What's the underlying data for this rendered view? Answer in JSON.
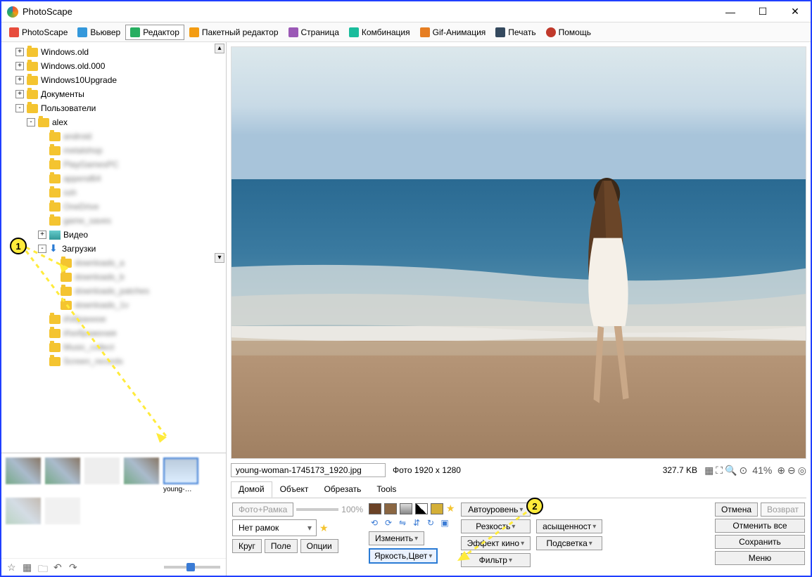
{
  "app": {
    "title": "PhotoScape"
  },
  "toolbar": {
    "tabs": [
      {
        "label": "PhotoScape",
        "active": false
      },
      {
        "label": "Вьювер",
        "active": false
      },
      {
        "label": "Редактор",
        "active": true
      },
      {
        "label": "Пакетный редактор",
        "active": false
      },
      {
        "label": "Страница",
        "active": false
      },
      {
        "label": "Комбинация",
        "active": false
      },
      {
        "label": "Gif-Анимация",
        "active": false
      },
      {
        "label": "Печать",
        "active": false
      },
      {
        "label": "Помощь",
        "active": false
      }
    ]
  },
  "tree": {
    "nodes": [
      {
        "depth": 1,
        "toggle": "+",
        "icon": "folder",
        "label": "Windows.old"
      },
      {
        "depth": 1,
        "toggle": "+",
        "icon": "folder",
        "label": "Windows.old.000"
      },
      {
        "depth": 1,
        "toggle": "+",
        "icon": "folder",
        "label": "Windows10Upgrade"
      },
      {
        "depth": 1,
        "toggle": "+",
        "icon": "folder",
        "label": "Документы"
      },
      {
        "depth": 1,
        "toggle": "-",
        "icon": "folder",
        "label": "Пользователи"
      },
      {
        "depth": 2,
        "toggle": "-",
        "icon": "folder",
        "label": "alex"
      },
      {
        "depth": 3,
        "toggle": "",
        "icon": "folder",
        "label": "android",
        "blur": true
      },
      {
        "depth": 3,
        "toggle": "",
        "icon": "folder",
        "label": "metalshop",
        "blur": true
      },
      {
        "depth": 3,
        "toggle": "",
        "icon": "folder",
        "label": "PlayGamesPC",
        "blur": true
      },
      {
        "depth": 3,
        "toggle": "",
        "icon": "folder",
        "label": "append64",
        "blur": true
      },
      {
        "depth": 3,
        "toggle": "",
        "icon": "folder",
        "label": "ssh",
        "blur": true
      },
      {
        "depth": 3,
        "toggle": "",
        "icon": "onedrive",
        "label": "OneDrive",
        "blur": true
      },
      {
        "depth": 3,
        "toggle": "",
        "icon": "folder",
        "label": "game_saves",
        "blur": true
      },
      {
        "depth": 3,
        "toggle": "+",
        "icon": "video",
        "label": "Видео"
      },
      {
        "depth": 3,
        "toggle": "-",
        "icon": "download",
        "label": "Загрузки"
      },
      {
        "depth": 4,
        "toggle": "",
        "icon": "folder",
        "label": "downloads_a",
        "blur": true
      },
      {
        "depth": 4,
        "toggle": "",
        "icon": "folder",
        "label": "downloads_b",
        "blur": true
      },
      {
        "depth": 4,
        "toggle": "",
        "icon": "folder",
        "label": "downloads_patches",
        "blur": true
      },
      {
        "depth": 4,
        "toggle": "",
        "icon": "folder",
        "label": "downloads_1v",
        "blur": true
      },
      {
        "depth": 3,
        "toggle": "",
        "icon": "folder",
        "label": "Избранное",
        "blur": true
      },
      {
        "depth": 3,
        "toggle": "",
        "icon": "folder",
        "label": "Изображения",
        "blur": true
      },
      {
        "depth": 3,
        "toggle": "",
        "icon": "folder",
        "label": "Music_collect",
        "blur": true
      },
      {
        "depth": 3,
        "toggle": "",
        "icon": "folder",
        "label": "Screen_records",
        "blur": true
      }
    ]
  },
  "thumbs": {
    "selected_label": "young-…"
  },
  "file": {
    "name": "young-woman-1745173_1920.jpg",
    "dimensions_label": "Фото 1920 x 1280",
    "size_label": "327.7 KB",
    "zoom": "41%"
  },
  "edit_tabs": [
    {
      "label": "Домой",
      "active": true
    },
    {
      "label": "Объект",
      "active": false
    },
    {
      "label": "Обрезать",
      "active": false
    },
    {
      "label": "Tools",
      "active": false
    }
  ],
  "panel": {
    "photo_frame": "Фото+Рамка",
    "slider_pct": "100%",
    "frame_select": "Нет рамок",
    "circle": "Круг",
    "field": "Поле",
    "options": "Опции",
    "autolevel": "Автоуровень",
    "sharpness": "Резкость",
    "saturation": "асыщенност",
    "resize": "Изменить",
    "film_effect": "Эффект кино",
    "highlight": "Подсветка",
    "brightness_color": "Яркость,Цвет",
    "filter": "Фильтр",
    "cancel": "Отмена",
    "redo": "Возврат",
    "undo_all": "Отменить все",
    "save": "Сохранить",
    "menu": "Меню"
  },
  "annotations": {
    "marker1": "1",
    "marker2": "2"
  }
}
